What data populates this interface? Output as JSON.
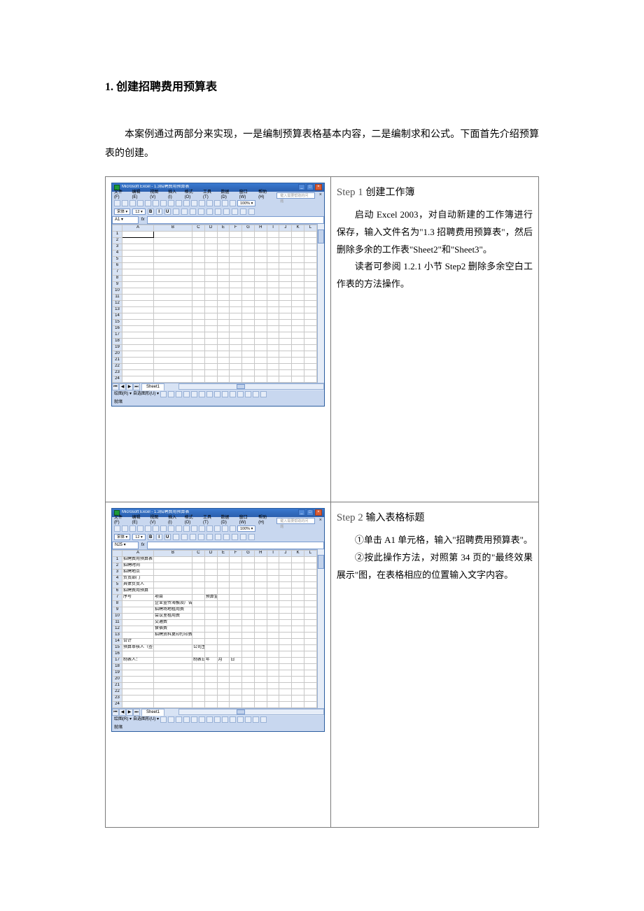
{
  "section": {
    "number": "1.",
    "title": "创建招聘费用预算表"
  },
  "intro": "本案例通过两部分来实现，一是编制预算表格基本内容，二是编制求和公式。下面首先介绍预算表的创建。",
  "excel_common": {
    "app_title": "Microsoft Excel - 1.3招聘费用预算表",
    "menus": [
      "文件(F)",
      "编辑(E)",
      "视图(V)",
      "插入(I)",
      "格式(O)",
      "工具(T)",
      "数据(D)",
      "窗口(W)",
      "帮助(H)"
    ],
    "help_placeholder": "键入需要帮助的问题",
    "menu_close": "×",
    "zoom": "100%",
    "font_name": "宋体",
    "font_size": "12",
    "sheet_tab": "Sheet1",
    "status_text": "就绪",
    "columns": [
      "A",
      "B",
      "C",
      "D",
      "E",
      "F",
      "G",
      "H",
      "I",
      "J",
      "K",
      "L"
    ],
    "draw_label": "绘图(R)",
    "autoshape_label": "自选图形(U)"
  },
  "steps": [
    {
      "label": "Step 1",
      "title": "创建工作簿",
      "body": [
        "启动 Excel 2003，对自动新建的工作簿进行保存，输入文件名为\"1.3 招聘费用预算表\"，然后删除多余的工作表\"Sheet2\"和\"Sheet3\"。",
        "读者可参阅 1.2.1 小节 Step2 删除多余空白工作表的方法操作。"
      ],
      "excel": {
        "name_box": "A1",
        "formula_bar_value": "",
        "rows_count": 24,
        "active_cell": {
          "row": 1,
          "col": "A"
        },
        "cells": {}
      }
    },
    {
      "label": "Step 2",
      "title": "输入表格标题",
      "body": [
        "①单击 A1 单元格，输入\"招聘费用预算表\"。",
        "②按此操作方法，对照第 34 页的\"最终效果展示\"图，在表格相应的位置输入文字内容。"
      ],
      "excel": {
        "name_box": "N25",
        "formula_bar_value": "",
        "rows_count": 24,
        "active_cell": null,
        "cells": {
          "A1": "招聘费用预算表",
          "A2": "招聘时间",
          "A3": "招聘地点",
          "A4": "负责部门",
          "A5": "具体负责人",
          "A6": "招聘费用预算",
          "A7": "序号",
          "B7": "项目",
          "D7": "预算金额（元）",
          "B8": "企业宣传海报及广告制作费",
          "B9": "招聘场地租用费",
          "B10": "会议室租用费",
          "B11": "交通费",
          "B12": "食宿费",
          "B13": "招聘资料复印打印费",
          "A14": "合计",
          "A15": "预算审核人（签字）：",
          "C15": "公司主管领导审批（签字）：",
          "A17": "制表人：",
          "C17": "制表日期：",
          "D17": "年",
          "E17": "月",
          "F17": "日"
        }
      }
    }
  ]
}
